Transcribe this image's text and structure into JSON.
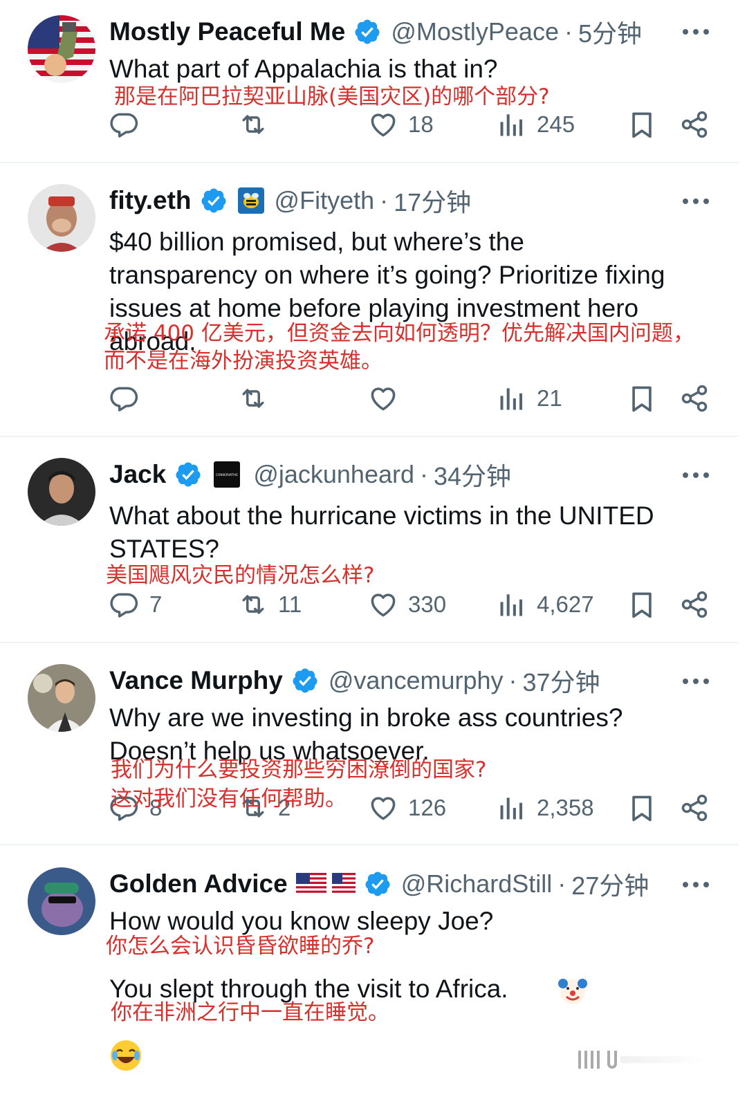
{
  "tweets": [
    {
      "name": "Mostly Peaceful Me",
      "handle": "@MostlyPeace",
      "time": "5分钟",
      "text": "What part of Appalachia is that in?",
      "translation": "那是在阿巴拉契亚山脉(美国灾区)的哪个部分?",
      "views": "245",
      "likes": "18"
    },
    {
      "name": "fity.eth",
      "handle": "@Fityeth",
      "time": "17分钟",
      "text_lines": [
        "$40 billion promised, but where’s the",
        "transparency on where it’s going? Prioritize fixing",
        "issues at home before playing investment hero",
        "abroad."
      ],
      "translation_lines": [
        "承诺 400 亿美元，但资金去向如何透明？优先解决国内问题，",
        "而不是在海外扮演投资英雄。"
      ],
      "views": "21"
    },
    {
      "name": "Jack",
      "handle": "@jackunheard",
      "time": "34分钟",
      "badge_text": "CONSERVATIVE",
      "text_lines": [
        "What about the hurricane victims in the UNITED",
        "STATES?"
      ],
      "translation": "美国飓风灾民的情况怎么样?",
      "replies": "7",
      "reposts": "11",
      "likes": "330",
      "views": "4,627"
    },
    {
      "name": "Vance Murphy",
      "handle": "@vancemurphy",
      "time": "37分钟",
      "text_lines": [
        "Why are we investing in broke ass countries?",
        "Doesn’t help us whatsoever."
      ],
      "translation_lines": [
        "我们为什么要投资那些穷困潦倒的国家?",
        "这对我们没有任何帮助。"
      ],
      "replies": "8",
      "reposts": "2",
      "likes": "126",
      "views": "2,358"
    },
    {
      "name": "Golden Advice",
      "handle": "@RichardStill",
      "time": "27分钟",
      "text": "How would you know sleepy Joe?",
      "translation": "你怎么会认识昏昏欲睡的乔?",
      "text2": "You slept through the visit to Africa.",
      "translation2": "你在非洲之行中一直在睡觉。"
    }
  ],
  "separator": "·",
  "icons": [
    "reply-icon",
    "repost-icon",
    "like-icon",
    "views-icon",
    "bookmark-icon",
    "share-icon",
    "more-icon",
    "verified-icon",
    "clown-emoji",
    "laughing-emoji"
  ],
  "colors": {
    "verified": "#1d9bf0",
    "muted": "#536471",
    "translation": "#d6312d",
    "text": "#0f1419"
  }
}
